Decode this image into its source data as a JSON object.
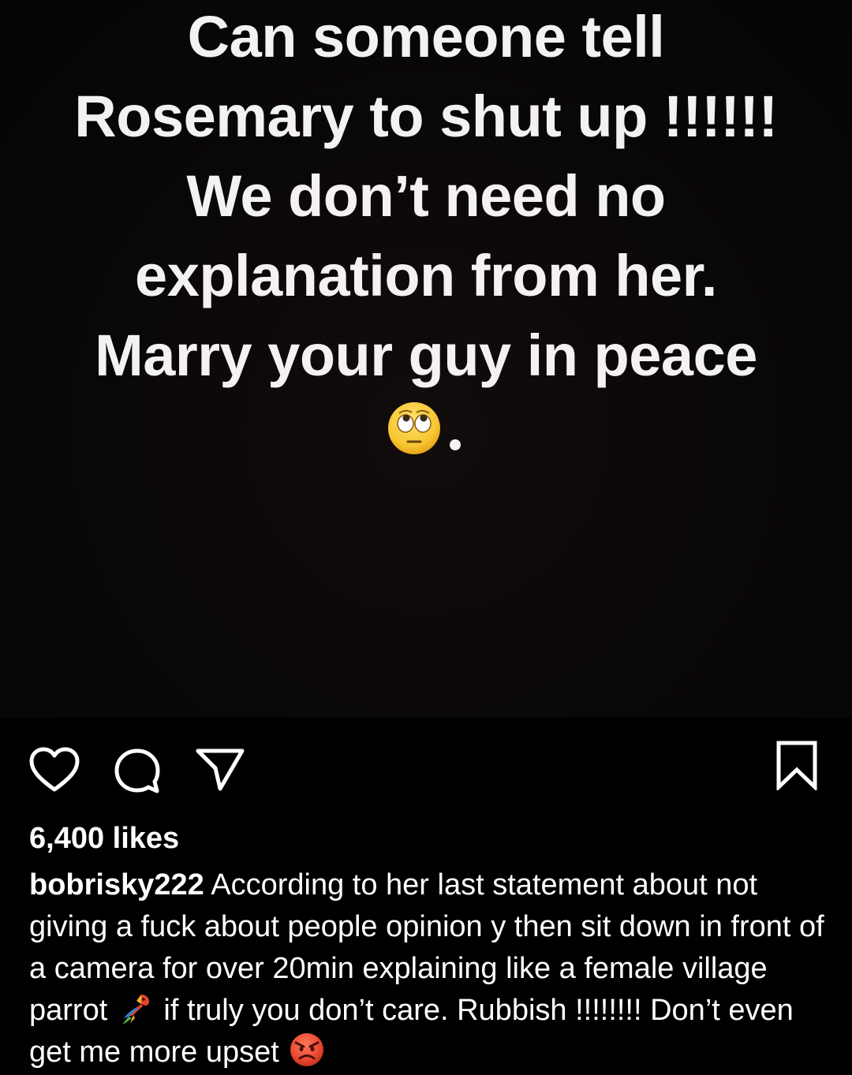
{
  "post": {
    "story_lines": [
      "Can someone tell",
      "Rosemary to shut up !!!!!!",
      "We don’t need no",
      "explanation from her.",
      "Marry your guy in peace"
    ],
    "story_end_emoji": "face-with-rolling-eyes-emoji",
    "story_end_punctuation": "."
  },
  "actions": {
    "like_icon": "heart-icon",
    "comment_icon": "comment-bubble-icon",
    "share_icon": "paper-plane-icon",
    "save_icon": "bookmark-icon"
  },
  "likes": {
    "label": "6,400 likes"
  },
  "caption": {
    "username": "bobrisky222",
    "text_part1": " According to her last statement about not giving a fuck about people opinion y then sit down in front of a camera for over 20min explaining like a female village parrot ",
    "emoji1": "parrot-emoji",
    "text_part2": " if truly you don’t care. Rubbish !!!!!!!! Don’t even get me more upset ",
    "emoji2": "angry-face-emoji"
  },
  "colors": {
    "background": "#000000",
    "text": "#ffffff",
    "emoji_yellow": "#f7c531",
    "angry_red": "#e8432f"
  }
}
